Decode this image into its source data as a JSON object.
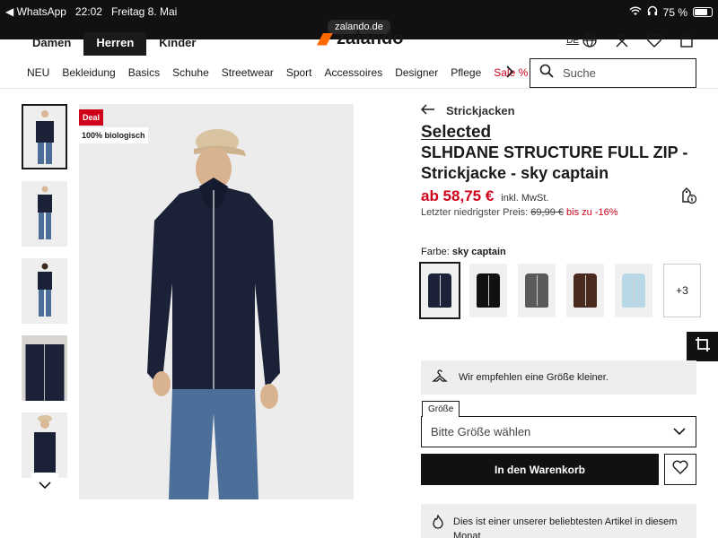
{
  "status_bar": {
    "back_app": "◀ WhatsApp",
    "time": "22:02",
    "date": "Freitag 8. Mai",
    "url": "zalando.de",
    "battery": "75 %"
  },
  "header": {
    "gender_tabs": [
      {
        "label": "Damen",
        "active": false
      },
      {
        "label": "Herren",
        "active": true
      },
      {
        "label": "Kinder",
        "active": false
      }
    ],
    "logo_text": "zalando",
    "language": "DE"
  },
  "categories": [
    {
      "label": "NEU"
    },
    {
      "label": "Bekleidung"
    },
    {
      "label": "Basics"
    },
    {
      "label": "Schuhe"
    },
    {
      "label": "Streetwear"
    },
    {
      "label": "Sport"
    },
    {
      "label": "Accessoires"
    },
    {
      "label": "Designer"
    },
    {
      "label": "Pflege"
    },
    {
      "label": "Sale %"
    }
  ],
  "search": {
    "placeholder": "Suche"
  },
  "gallery": {
    "badges": {
      "deal": "Deal",
      "bio": "100% biologisch"
    }
  },
  "product": {
    "breadcrumb": "Strickjacken",
    "brand": "Selected",
    "title": "SLHDANE STRUCTURE FULL ZIP - Strickjacke - sky captain",
    "price": "ab 58,75 €",
    "tax_note": "inkl. MwSt.",
    "lowest_label": "Letzter niedrigster Preis:",
    "lowest_price": "69,99 €",
    "lowest_discount": "bis zu -16%",
    "color_label": "Farbe:",
    "color_value": "sky captain",
    "swatches": [
      {
        "color": "#1b2238",
        "active": true
      },
      {
        "color": "#111111",
        "active": false
      },
      {
        "color": "#5a5a58",
        "active": false
      },
      {
        "color": "#4a2a1e",
        "active": false
      },
      {
        "color": "#b9d8e6",
        "active": false
      }
    ],
    "more_colors": "+3",
    "size_tip": "Wir empfehlen eine Größe kleiner.",
    "size_legend": "Größe",
    "size_placeholder": "Bitte Größe wählen",
    "cart_label": "In den Warenkorb",
    "popular_text": "Dies ist einer unserer beliebtesten Artikel in diesem Monat"
  },
  "colors": {
    "brand_orange": "#ff6900",
    "sale_red": "#d0021b",
    "dark": "#1a1a1a"
  }
}
